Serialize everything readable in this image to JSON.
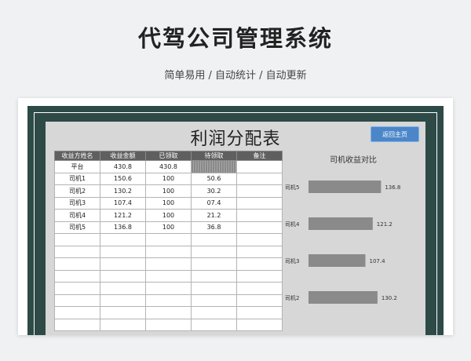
{
  "banner": {
    "title": "代驾公司管理系统",
    "subtitle": "简单易用 / 自动统计 / 自动更新"
  },
  "sheet": {
    "title": "利润分配表",
    "home_button": "返回主页",
    "columns": [
      "收益方姓名",
      "收益金额",
      "已领取",
      "待领取",
      "备注"
    ],
    "rows": [
      [
        "平台",
        "430.8",
        "430.8",
        "",
        ""
      ],
      [
        "司机1",
        "150.6",
        "100",
        "50.6",
        ""
      ],
      [
        "司机2",
        "130.2",
        "100",
        "30.2",
        ""
      ],
      [
        "司机3",
        "107.4",
        "100",
        "07.4",
        ""
      ],
      [
        "司机4",
        "121.2",
        "100",
        "21.2",
        ""
      ],
      [
        "司机5",
        "136.8",
        "100",
        "36.8",
        ""
      ]
    ],
    "empty_rows": 8
  },
  "chart_data": {
    "type": "bar",
    "title": "司机收益对比",
    "categories": [
      "司机5",
      "司机4",
      "司机3",
      "司机2"
    ],
    "values": [
      136.8,
      121.2,
      107.4,
      130.2
    ],
    "bar_color": "#8a8a8a"
  },
  "colors": {
    "frame": "#2d4a47",
    "button": "#4a86c8",
    "header": "#5f5f5f"
  }
}
